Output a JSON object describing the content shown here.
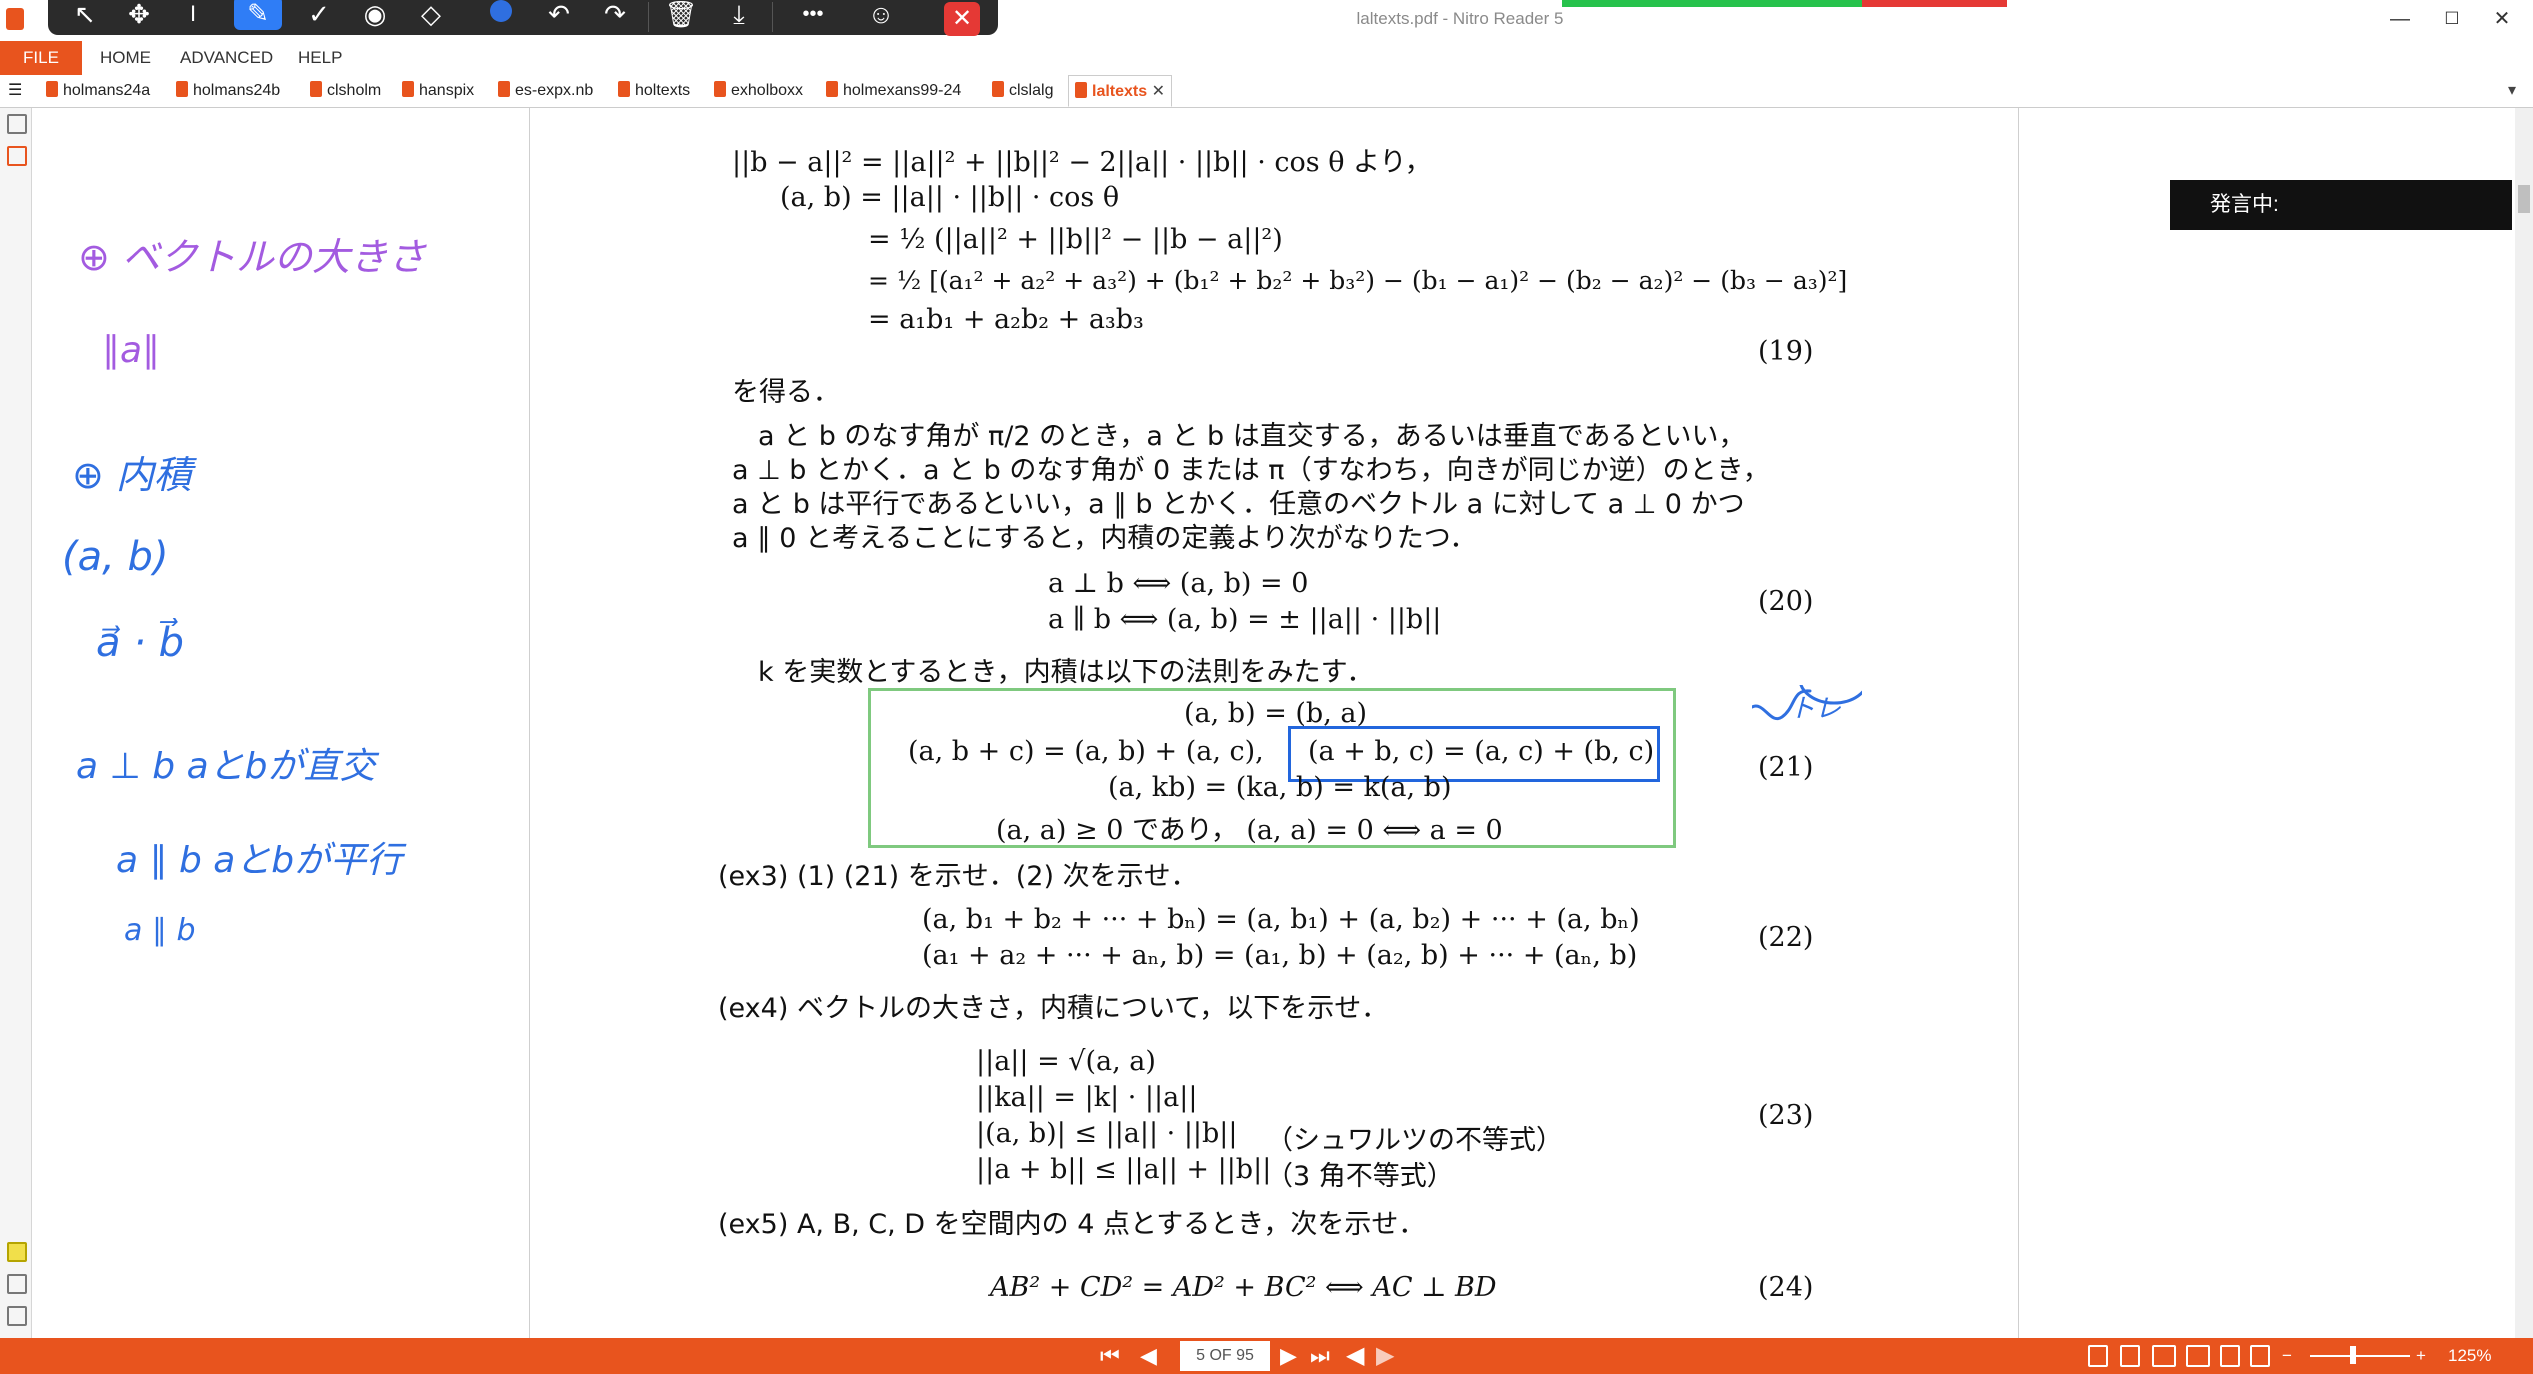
{
  "window": {
    "title": "laltexts.pdf - Nitro Reader 5",
    "controls": [
      "minimize-icon",
      "maximize-icon",
      "close-icon"
    ]
  },
  "toolbar": {
    "tools": [
      "select-arrow-icon",
      "pan-icon",
      "text-cursor-icon",
      "pen-icon",
      "check-icon",
      "stamp-icon",
      "eraser-icon",
      "color-dot-icon",
      "undo-icon",
      "redo-icon",
      "trash-icon",
      "download-icon",
      "more-icon",
      "user-icon",
      "close-icon"
    ],
    "active_tool": "pen-icon",
    "pen_color": "#2f6fe0",
    "close_label": "✕",
    "more_label": "•••"
  },
  "menu": {
    "file": "FILE",
    "items": [
      "HOME",
      "ADVANCED",
      "HELP"
    ]
  },
  "tabs": [
    "holmans24a",
    "holmans24b",
    "clsholm",
    "hanspix",
    "es-expx.nb",
    "holtexts",
    "exholboxx",
    "holmexans99-24",
    "clslalg",
    "laltexts"
  ],
  "active_tab": "laltexts",
  "tab_close": "✕",
  "speaking_label": "発言中:",
  "handwritten_notes": [
    "⊕ ベクトルの大きさ",
    "∥a∥",
    "⊕ 内積",
    "(a, b)",
    "a⃗ · b⃗",
    "a ⊥ b  aとbが直交",
    "a ∥ b  aとbが平行",
    "a ∥ b"
  ],
  "handwritten_annotation": "トレ",
  "colors": {
    "accent": "#e8541e",
    "ink_purple": "#a35be0",
    "ink_blue": "#2f6fe0",
    "green_box": "#7fc97f",
    "blue_box": "#2266dd"
  },
  "doc": {
    "eq_lines": [
      "||b − a||² = ||a||² + ||b||² − 2||a|| · ||b|| · cos θ   より，",
      "(a, b) = ||a|| · ||b|| · cos θ",
      "= ½ (||a||² + ||b||² − ||b − a||²)",
      "= ½ [(a₁² + a₂² + a₃²) + (b₁² + b₂² + b₃²) − (b₁ − a₁)² − (b₂ − a₂)² − (b₃ − a₃)²]",
      "= a₁b₁ + a₂b₂ + a₃b₃"
    ],
    "eq19": "(19)",
    "gettext": "を得る．",
    "para": [
      "a と b のなす角が π/2 のとき，a と b は直交する，あるいは垂直であるといい，",
      "a ⊥ b とかく．a と b のなす角が 0 または π（すなわち，向きが同じか逆）のとき，",
      "a と b は平行であるといい，a ∥ b とかく．任意のベクトル a に対して a ⊥ 0 かつ",
      "a ∥ 0 と考えることにすると，内積の定義より次がなりたつ．"
    ],
    "eq20": [
      "a ⊥ b   ⟺   (a, b) = 0",
      "a ∥ b   ⟺   (a, b) = ± ||a|| · ||b||"
    ],
    "eq20_num": "(20)",
    "ktext": "k を実数とするとき，内積は以下の法則をみたす．",
    "eq21": [
      "(a, b) = (b, a)",
      "(a, b + c) = (a, b) + (a, c),",
      "(a + b, c) = (a, c) + (b, c)",
      "(a, kb) = (ka, b) = k(a, b)",
      "(a, a) ≥ 0   であり，  (a, a) = 0 ⟺ a = 0"
    ],
    "eq21_num": "(21)",
    "ex3": "(ex3) (1) (21) を示せ．(2) 次を示せ．",
    "eq22": [
      "(a, b₁ + b₂ + ··· + bₙ) = (a, b₁) + (a, b₂) + ··· + (a, bₙ)",
      "(a₁ + a₂ + ··· + aₙ, b) = (a₁, b) + (a₂, b) + ··· + (aₙ, b)"
    ],
    "eq22_num": "(22)",
    "ex4": "(ex4) ベクトルの大きさ，内積について，以下を示せ．",
    "eq23": [
      "||a|| = √(a, a)",
      "||ka|| = |k| · ||a||",
      "|(a, b)| ≤ ||a|| · ||b||",
      "||a + b|| ≤ ||a|| + ||b||"
    ],
    "eq23_notes": [
      "（シュワルツの不等式）",
      "（3 角不等式）"
    ],
    "eq23_num": "(23)",
    "ex5": "(ex5) A, B, C, D を空間内の 4 点とするとき，次を示せ．",
    "eq24": "AB² + CD² = AD² + BC²  ⟺  AC ⊥ BD",
    "eq24_num": "(24)"
  },
  "status": {
    "page": "5 OF 95",
    "zoom": "125%",
    "zoom_minus": "−",
    "zoom_plus": "+"
  }
}
